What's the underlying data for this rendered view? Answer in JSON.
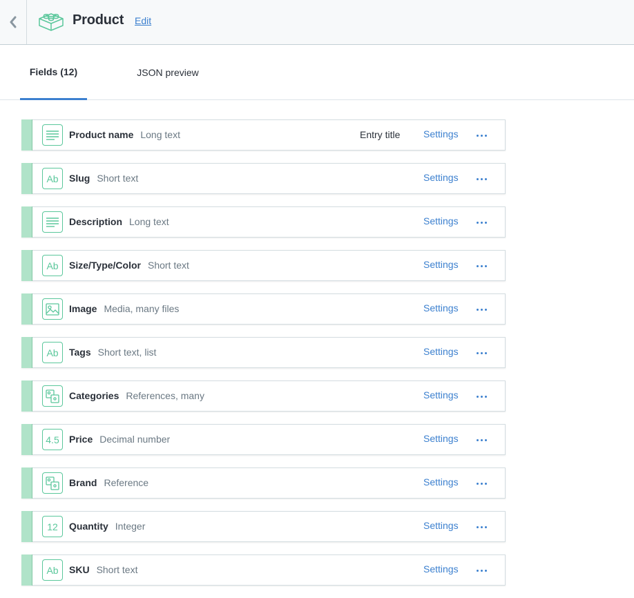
{
  "header": {
    "title": "Product",
    "edit_label": "Edit"
  },
  "tabs": [
    {
      "label": "Fields (12)",
      "active": true
    },
    {
      "label": "JSON preview",
      "active": false
    }
  ],
  "fields": [
    {
      "name": "Product name",
      "type": "Long text",
      "icon": "long-text-icon",
      "entry_title": "Entry title",
      "settings": "Settings"
    },
    {
      "name": "Slug",
      "type": "Short text",
      "icon": "short-text-icon",
      "settings": "Settings"
    },
    {
      "name": "Description",
      "type": "Long text",
      "icon": "long-text-icon",
      "settings": "Settings"
    },
    {
      "name": "Size/Type/Color",
      "type": "Short text",
      "icon": "short-text-icon",
      "settings": "Settings"
    },
    {
      "name": "Image",
      "type": "Media, many files",
      "icon": "media-icon",
      "settings": "Settings"
    },
    {
      "name": "Tags",
      "type": "Short text, list",
      "icon": "short-text-icon",
      "settings": "Settings"
    },
    {
      "name": "Categories",
      "type": "References, many",
      "icon": "reference-icon",
      "settings": "Settings"
    },
    {
      "name": "Price",
      "type": "Decimal number",
      "icon": "decimal-icon",
      "icon_text": "4.5",
      "settings": "Settings"
    },
    {
      "name": "Brand",
      "type": "Reference",
      "icon": "reference-icon",
      "settings": "Settings"
    },
    {
      "name": "Quantity",
      "type": "Integer",
      "icon": "integer-icon",
      "icon_text": "12",
      "settings": "Settings"
    },
    {
      "name": "SKU",
      "type": "Short text",
      "icon": "short-text-icon",
      "settings": "Settings"
    }
  ],
  "icon_text": {
    "short_text": "Ab"
  },
  "colors": {
    "accent": "#3c80cf",
    "field_green": "#5ac79b",
    "handle_green": "#b0e3c9",
    "header_bg": "#f7f9fa"
  }
}
